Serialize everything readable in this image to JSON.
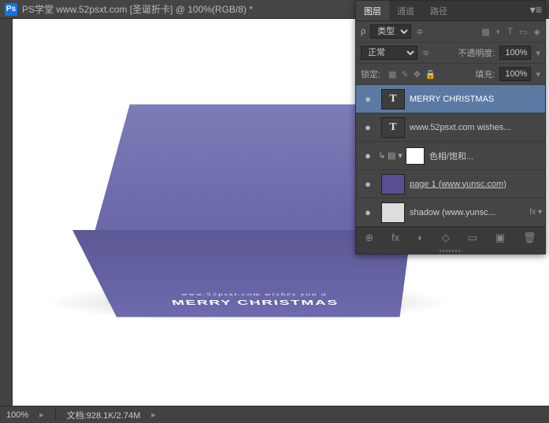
{
  "titlebar": {
    "app_icon": "Ps",
    "title": "PS学堂 www.52psxt.com [圣诞折卡] @ 100%(RGB/8) *"
  },
  "canvas": {
    "line1": "www.52psxt.com wishes you a",
    "line2": "MERRY CHRISTMAS"
  },
  "panel": {
    "tabs": {
      "layers": "图层",
      "channels": "通道",
      "paths": "路径"
    },
    "filter": {
      "label": "类型",
      "icons": [
        "▦",
        "◐",
        "T",
        "▭",
        "◈"
      ]
    },
    "blend": {
      "mode": "正常",
      "opacity_label": "不透明度:",
      "opacity_value": "100%"
    },
    "lock": {
      "label": "锁定:",
      "fill_label": "填充:",
      "fill_value": "100%"
    },
    "layers": [
      {
        "eye": "●",
        "thumb": "T",
        "name": "MERRY CHRISTMAS",
        "selected": true
      },
      {
        "eye": "●",
        "thumb": "T",
        "name": "www.52psxt.com wishes...",
        "selected": false
      },
      {
        "eye": "●",
        "thumb": "adj",
        "name": "色相/饱和...",
        "selected": false,
        "hasMask": true,
        "hasAdj": true
      },
      {
        "eye": "●",
        "thumb": "img",
        "name": "page 1 (www.yunsc.com)",
        "selected": false,
        "underline": true
      },
      {
        "eye": "●",
        "thumb": "shadow",
        "name": "shadow (www.yunsc...",
        "selected": false,
        "fx": "fx ▾"
      }
    ],
    "footer_icons": [
      "⊕",
      "fx",
      "◐",
      "◇",
      "▭",
      "🗑"
    ]
  },
  "statusbar": {
    "zoom": "100%",
    "doc_label": "文档:",
    "doc_value": "928.1K/2.74M"
  }
}
